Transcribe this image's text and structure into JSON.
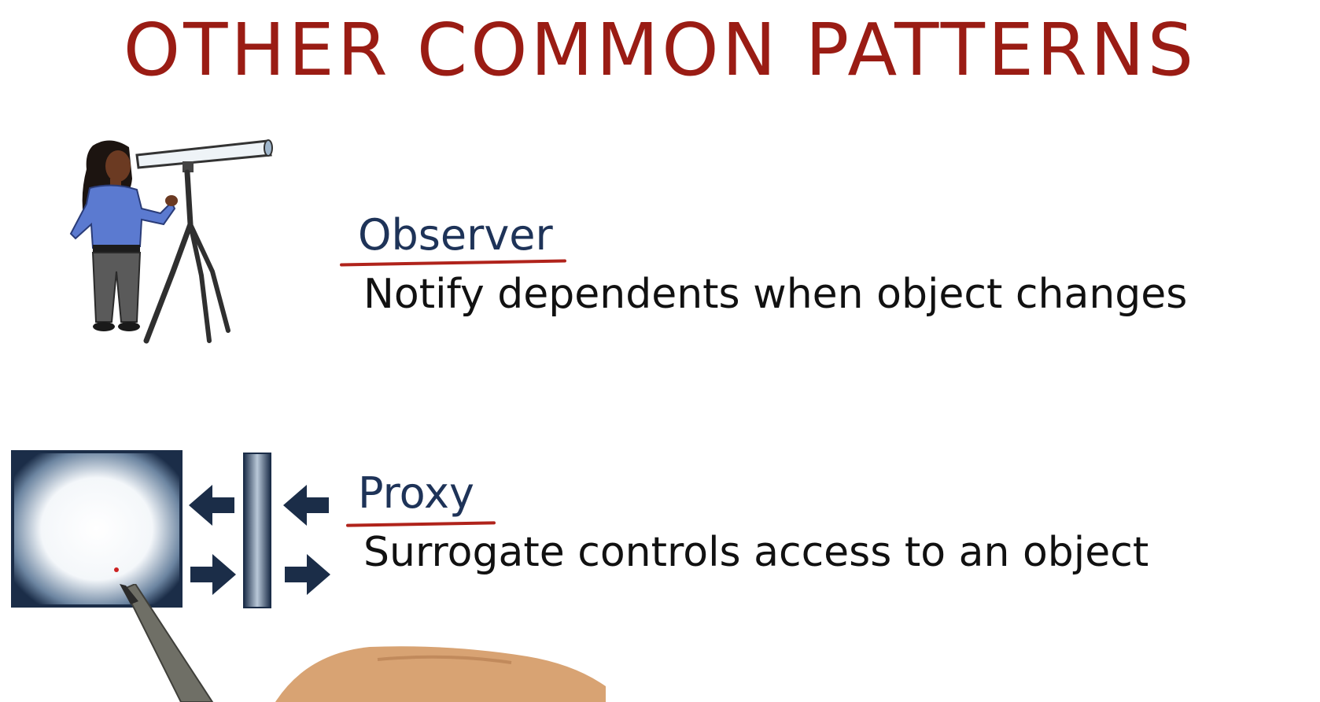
{
  "title": "OTHER COMMON PATTERNS",
  "patterns": [
    {
      "name": "Observer",
      "description": "Notify dependents when object changes",
      "illustration": "person-with-telescope"
    },
    {
      "name": "Proxy",
      "description": "Surrogate controls access to an object",
      "illustration": "proxy-box-with-arrows"
    }
  ],
  "colors": {
    "title": "#9a1c14",
    "pattern_name": "#1e3358",
    "underline": "#b0231b",
    "description": "#111111",
    "box_dark": "#1b2d48"
  },
  "icons": [
    "telescope-icon",
    "person-icon",
    "arrow-left-icon",
    "arrow-right-icon",
    "pen-icon"
  ]
}
